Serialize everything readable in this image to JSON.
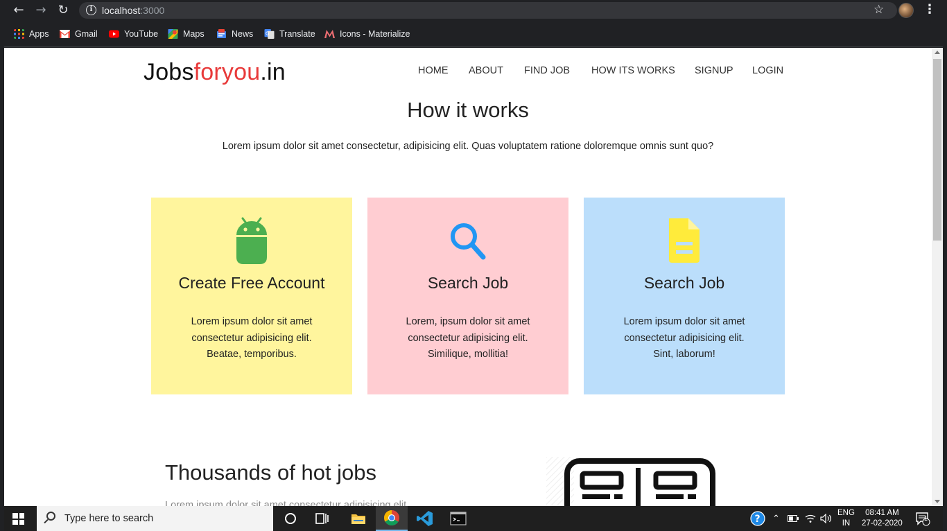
{
  "browser": {
    "url_host": "localhost",
    "url_port": ":3000"
  },
  "bookmarks": [
    {
      "label": "Apps",
      "icon": "apps-grid-icon",
      "color": "#4285f4"
    },
    {
      "label": "Gmail",
      "icon": "gmail-icon",
      "color": "#ea4335"
    },
    {
      "label": "YouTube",
      "icon": "youtube-icon",
      "color": "#ff0000"
    },
    {
      "label": "Maps",
      "icon": "maps-icon",
      "color": "#34a853"
    },
    {
      "label": "News",
      "icon": "news-icon",
      "color": "#4285f4"
    },
    {
      "label": "Translate",
      "icon": "translate-icon",
      "color": "#4285f4"
    },
    {
      "label": "Icons - Materialize",
      "icon": "materialize-icon",
      "color": "#ee6e73"
    }
  ],
  "site": {
    "logo_part1": "Jobs",
    "logo_part2": "foryou",
    "logo_part3": ".in",
    "logo_accent_color": "#e83a3a",
    "nav": [
      "HOME",
      "ABOUT",
      "FIND JOB",
      "HOW ITS WORKS",
      "SIGNUP",
      "LOGIN"
    ]
  },
  "how_it_works": {
    "title": "How it works",
    "subtitle": "Lorem ipsum dolor sit amet consectetur, adipisicing elit. Quas voluptatem ratione doloremque omnis sunt quo?",
    "cards": [
      {
        "title": "Create Free Account",
        "lines": [
          "Lorem ipsum dolor sit amet",
          "consectetur adipisicing elit.",
          "Beatae, temporibus."
        ],
        "bg": "#fff59d",
        "icon": "android-icon",
        "icon_color": "#4caf50"
      },
      {
        "title": "Search Job",
        "lines": [
          "Lorem, ipsum dolor sit amet",
          "consectetur adipisicing elit.",
          "Similique, mollitia!"
        ],
        "bg": "#ffcdd2",
        "icon": "search-icon",
        "icon_color": "#2196f3"
      },
      {
        "title": "Search Job",
        "lines": [
          "Lorem ipsum dolor sit amet",
          "consectetur adipisicing elit.",
          "Sint, laborum!"
        ],
        "bg": "#bbdefb",
        "icon": "document-icon",
        "icon_color": "#ffeb3b"
      }
    ]
  },
  "hot_jobs": {
    "title": "Thousands of hot jobs",
    "text": "Lorem ipsum dolor sit amet consectetur adipisicing elit."
  },
  "taskbar": {
    "search_placeholder": "Type here to search",
    "lang_top": "ENG",
    "lang_bottom": "IN",
    "time": "08:41 AM",
    "date": "27-02-2020",
    "notification_count": "1"
  }
}
